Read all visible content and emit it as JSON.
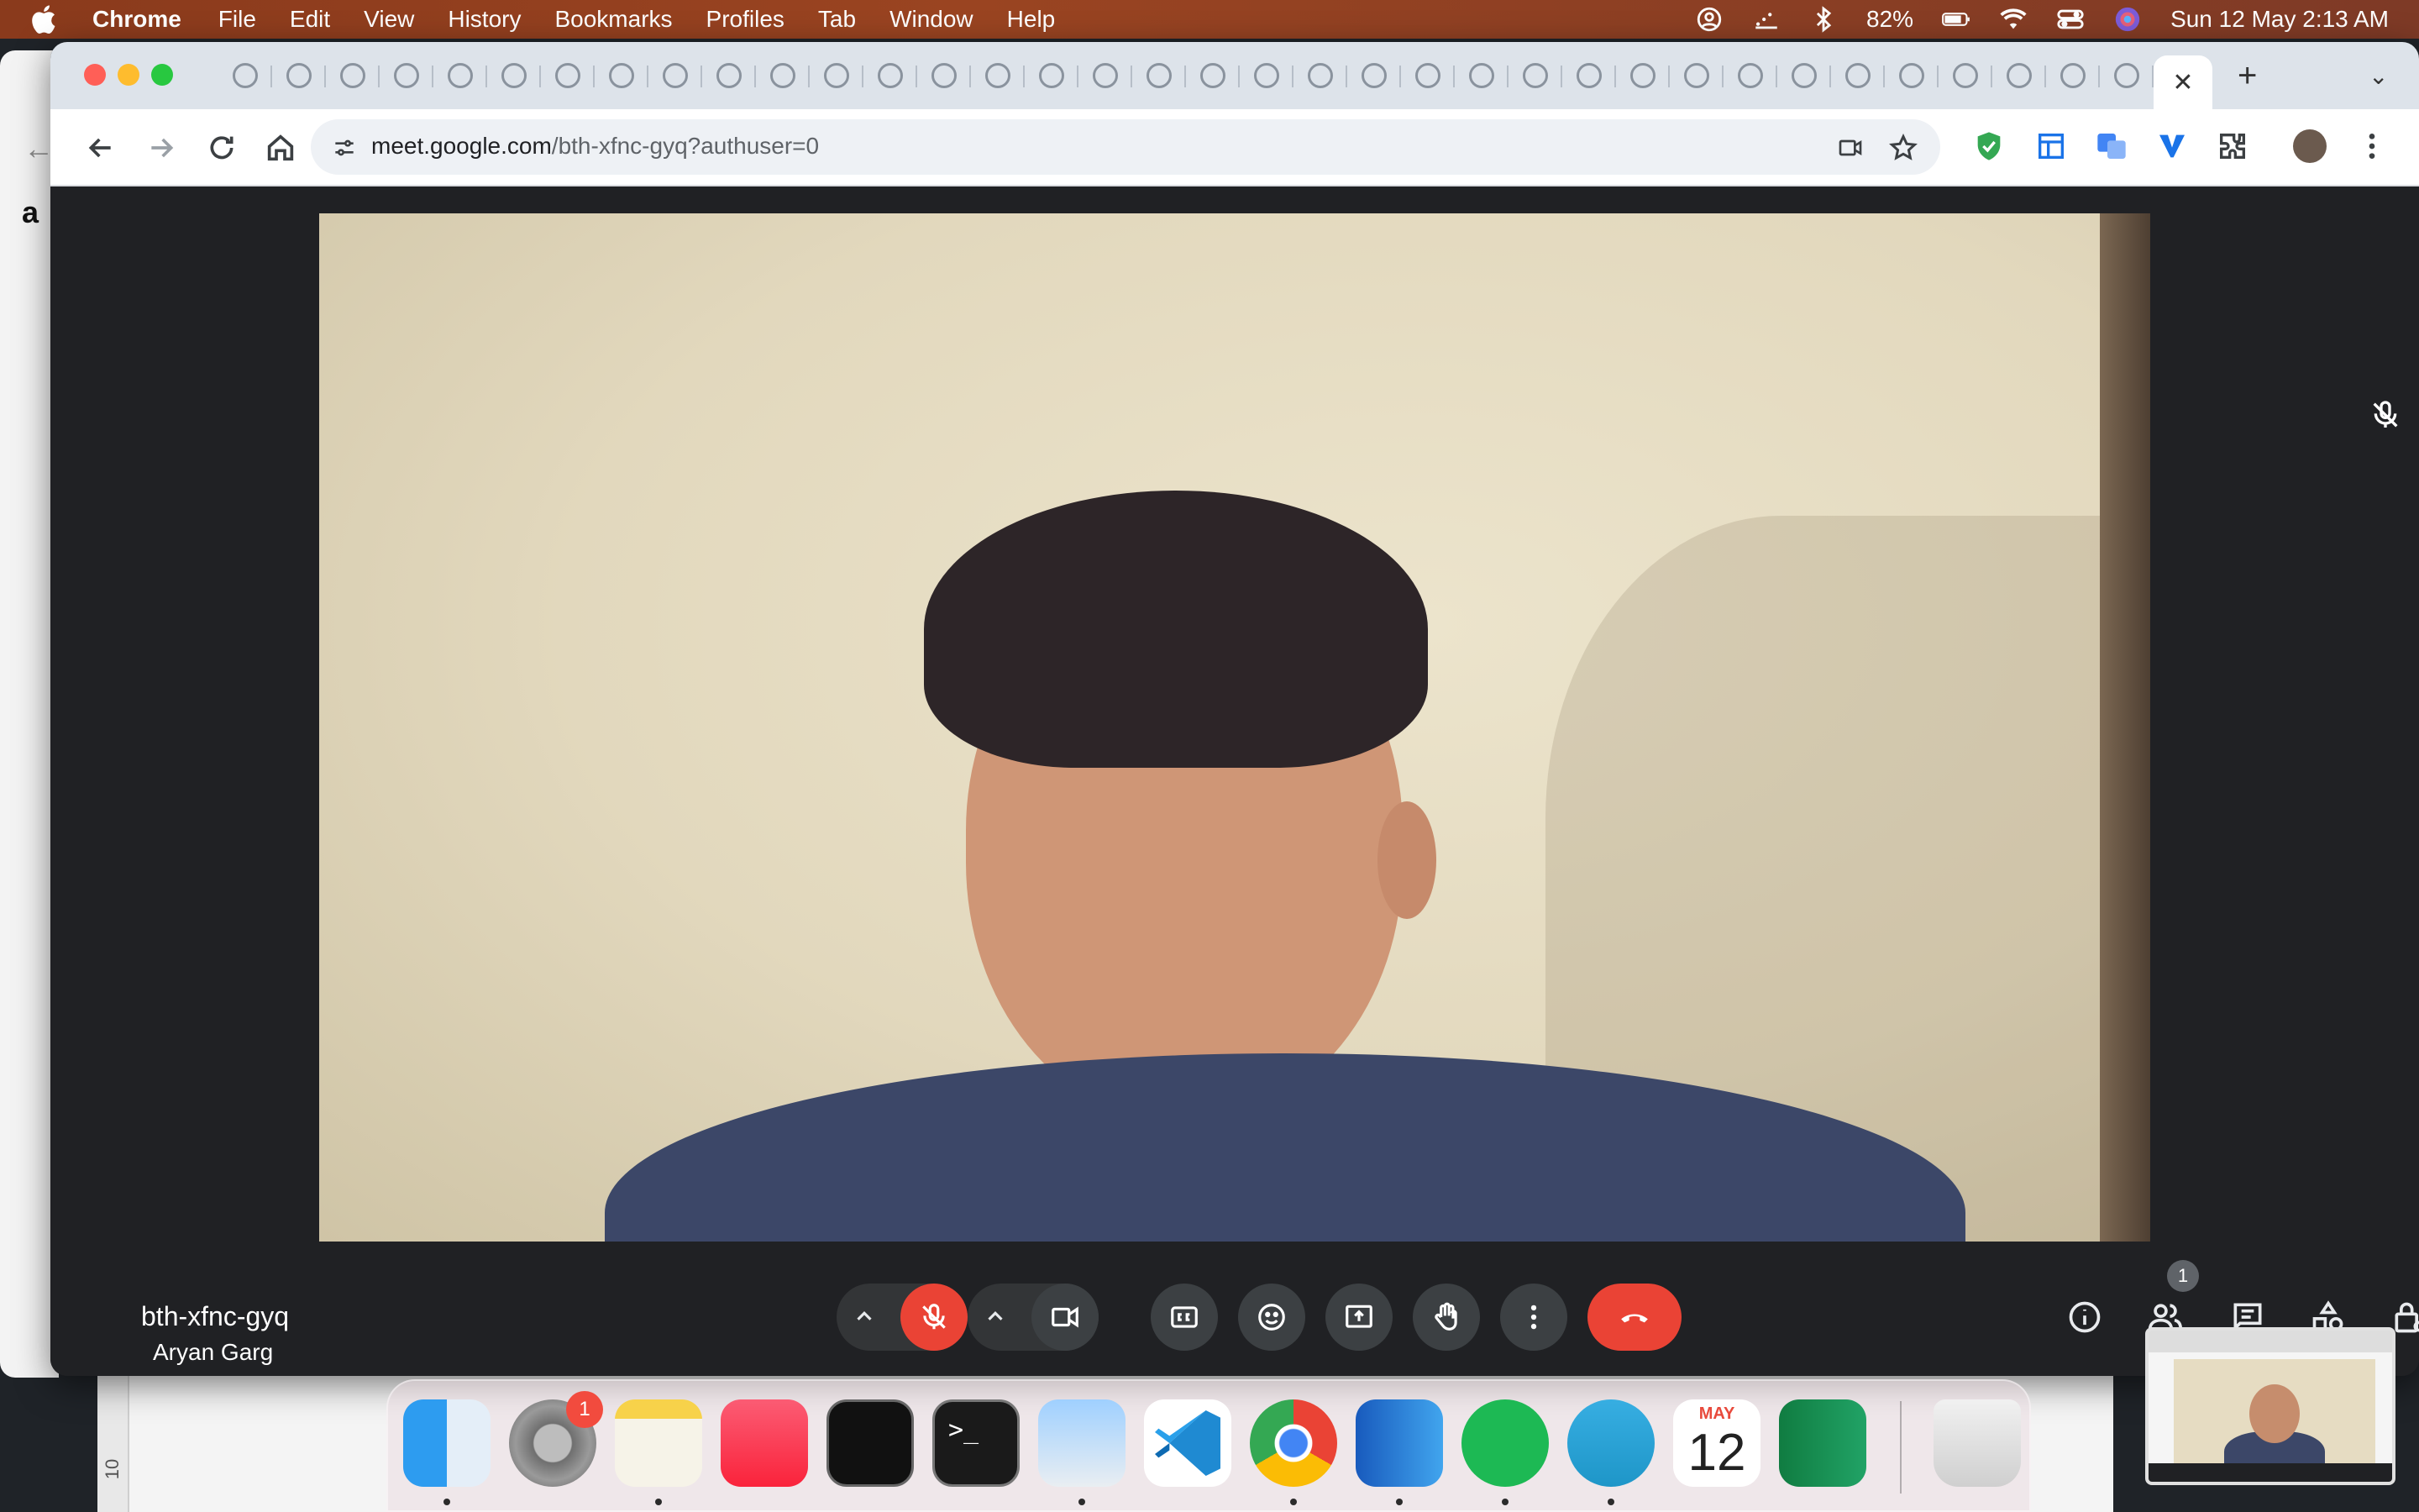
{
  "menubar": {
    "app_name": "Chrome",
    "items": [
      "File",
      "Edit",
      "View",
      "History",
      "Bookmarks",
      "Profiles",
      "Tab",
      "Window",
      "Help"
    ],
    "battery": "82%",
    "datetime": "Sun 12 May  2:13 AM"
  },
  "browser": {
    "url_host": "meet.google.com",
    "url_path": "/bth-xfnc-gyq?authuser=0",
    "tab_icons": [
      "github-icon",
      "vercel-icon",
      "chatgpt-icon",
      "researchgate-icon",
      "chatgpt-icon",
      "chatgpt-icon",
      "contact-card-icon",
      "site-icon",
      "site-icon",
      "site-icon",
      "docs-icon",
      "google-icon",
      "google-icon",
      "s-icon",
      "site-icon",
      "site-icon",
      "site-icon",
      "sn-icon",
      "settings-icon",
      "site-icon",
      "figma-icon",
      "gmail-icon",
      "site-icon",
      "site-icon",
      "site-icon",
      "gmail-icon",
      "sheets-icon",
      "google-icon",
      "site-icon",
      "site-icon",
      "gmail-icon",
      "gmail-icon",
      "gmail-icon",
      "site-icon",
      "gmail-icon",
      "contact-card-icon"
    ]
  },
  "meet": {
    "participant_name": "Aryan Garg",
    "meeting_code": "bth-xfnc-gyq",
    "people_count": "1",
    "mic_muted": true
  },
  "dock": {
    "settings_badge": "1",
    "calendar_month": "MAY",
    "calendar_day": "12",
    "apps": [
      "finder",
      "system-settings",
      "notes",
      "music",
      "activity-monitor",
      "terminal",
      "preview",
      "vscode",
      "chrome",
      "word",
      "spotify",
      "telegram",
      "calendar",
      "excel",
      "trash"
    ]
  },
  "desktop": {
    "ruler_label": "10"
  },
  "colors": {
    "accent_red": "#ea4335",
    "meet_background": "#202124",
    "control_gray": "#3c4043"
  }
}
